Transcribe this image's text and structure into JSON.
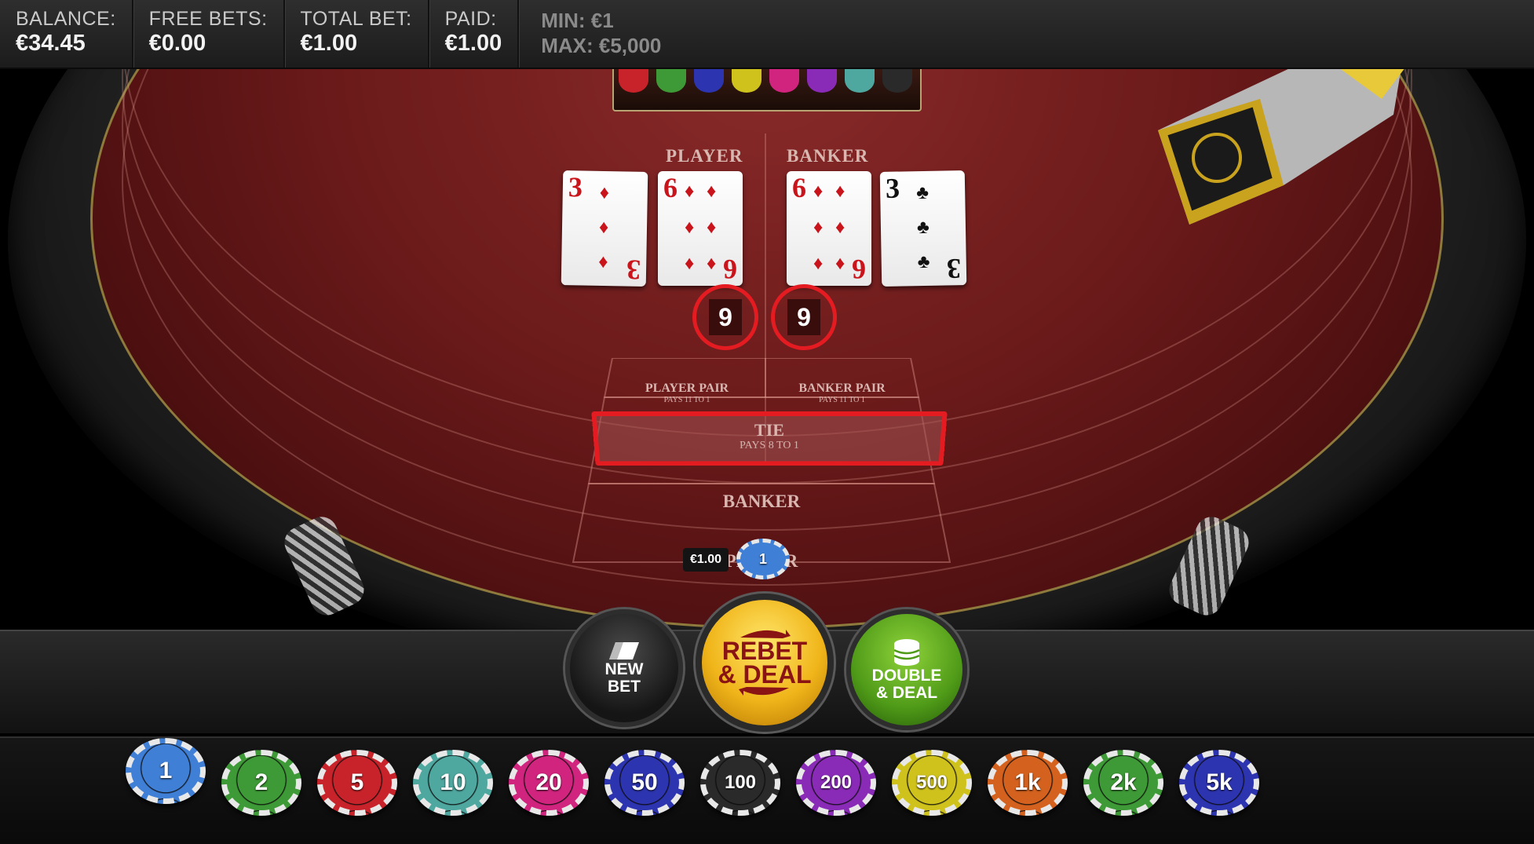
{
  "stats": [
    {
      "label": "BALANCE:",
      "value": "€34.45"
    },
    {
      "label": "FREE BETS:",
      "value": "€0.00"
    },
    {
      "label": "TOTAL BET:",
      "value": "€1.00"
    },
    {
      "label": "PAID:",
      "value": "€1.00"
    }
  ],
  "limits": {
    "min": "MIN: €1",
    "max": "MAX: €5,000"
  },
  "table": {
    "player_label": "PLAYER",
    "banker_label": "BANKER",
    "player_score": "9",
    "banker_score": "9",
    "player_cards": [
      {
        "rank": "3",
        "suit": "♦",
        "color": "red"
      },
      {
        "rank": "6",
        "suit": "♦",
        "color": "red"
      }
    ],
    "banker_cards": [
      {
        "rank": "6",
        "suit": "♦",
        "color": "red"
      },
      {
        "rank": "3",
        "suit": "♣",
        "color": "black"
      }
    ],
    "zones": {
      "player_pair": "PLAYER PAIR",
      "player_pair_pays": "PAYS 11 TO 1",
      "banker_pair": "BANKER PAIR",
      "banker_pair_pays": "PAYS 11 TO 1",
      "tie": "TIE",
      "tie_pays": "PAYS 8 TO 1",
      "banker": "BANKER",
      "player": "PLAYER"
    },
    "placed_bet": {
      "amount": "€1.00",
      "chip": "1"
    },
    "highlight_color": "#e51b22"
  },
  "controls": {
    "new_bet": {
      "line1": "NEW",
      "line2": "BET"
    },
    "rebet_deal": {
      "line1": "REBET",
      "line2": "& DEAL"
    },
    "double_deal": {
      "line1": "DOUBLE",
      "line2": "& DEAL"
    }
  },
  "chips": [
    {
      "label": "1",
      "color": "#3f7fd6",
      "selected": true
    },
    {
      "label": "2",
      "color": "#3e9a36"
    },
    {
      "label": "5",
      "color": "#c8232a"
    },
    {
      "label": "10",
      "color": "#4fa8a0"
    },
    {
      "label": "20",
      "color": "#d1247e"
    },
    {
      "label": "50",
      "color": "#2d34b0"
    },
    {
      "label": "100",
      "color": "#2a2a2a"
    },
    {
      "label": "200",
      "color": "#8a2bb8"
    },
    {
      "label": "500",
      "color": "#cfc21c"
    },
    {
      "label": "1k",
      "color": "#d4621e"
    },
    {
      "label": "2k",
      "color": "#3e9a36"
    },
    {
      "label": "5k",
      "color": "#2d34b0"
    }
  ]
}
